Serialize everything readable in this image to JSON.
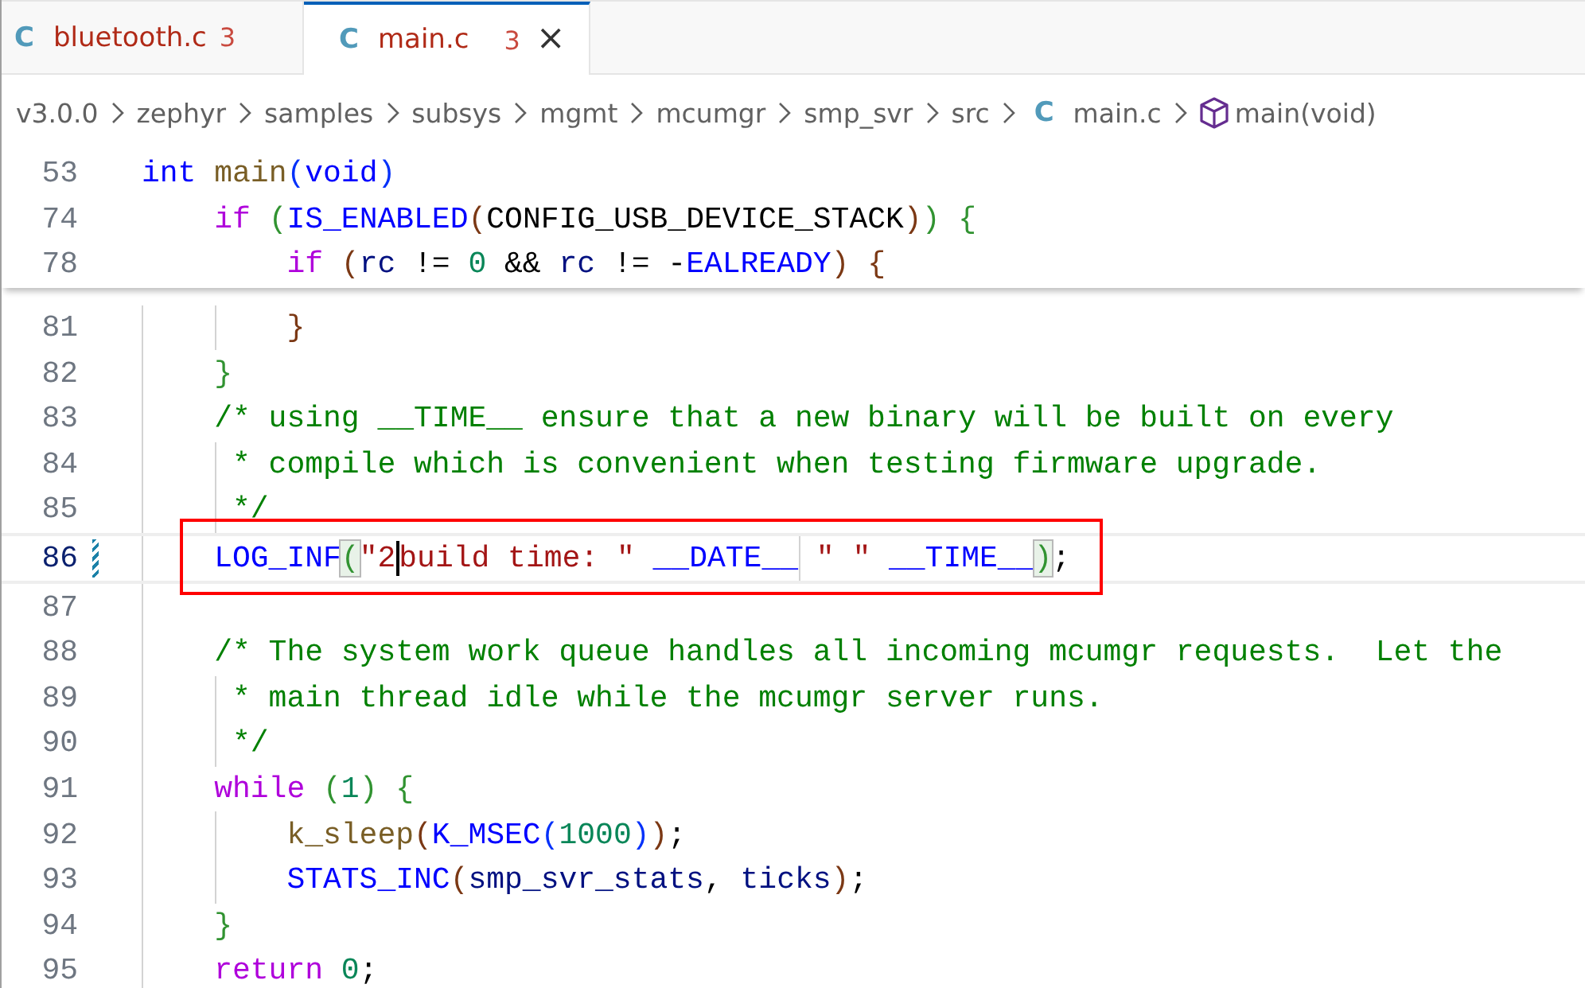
{
  "tabs": [
    {
      "icon": "C",
      "label": "bluetooth.c",
      "problems": "3",
      "selected": false
    },
    {
      "icon": "C",
      "label": "main.c",
      "problems": "3",
      "selected": true,
      "close": "×"
    }
  ],
  "breadcrumbs": [
    {
      "label": "v3.0.0",
      "kind": "folder"
    },
    {
      "label": "zephyr",
      "kind": "folder"
    },
    {
      "label": "samples",
      "kind": "folder"
    },
    {
      "label": "subsys",
      "kind": "folder"
    },
    {
      "label": "mgmt",
      "kind": "folder"
    },
    {
      "label": "mcumgr",
      "kind": "folder"
    },
    {
      "label": "smp_svr",
      "kind": "folder"
    },
    {
      "label": "src",
      "kind": "folder"
    },
    {
      "label": "main.c",
      "kind": "file",
      "icon": "C"
    },
    {
      "label": "main(void)",
      "kind": "symbol"
    }
  ],
  "sticky_lines": [
    {
      "number": "53",
      "tokens": [
        {
          "text": "int ",
          "kind": "kw"
        },
        {
          "text": "main",
          "kind": "fn"
        },
        {
          "text": "(",
          "kind": "b1"
        },
        {
          "text": "void",
          "kind": "kw"
        },
        {
          "text": ")",
          "kind": "b1"
        }
      ]
    },
    {
      "number": "74",
      "tokens": [
        {
          "text": "    if ",
          "kind": "ctrl"
        },
        {
          "text": "(",
          "kind": "b2"
        },
        {
          "text": "IS_ENABLED",
          "kind": "macro"
        },
        {
          "text": "(",
          "kind": "b3"
        },
        {
          "text": "CONFIG_USB_DEVICE_STACK",
          "kind": "plain"
        },
        {
          "text": ")",
          "kind": "b3"
        },
        {
          "text": ") ",
          "kind": "b2"
        },
        {
          "text": "{",
          "kind": "b2"
        }
      ]
    },
    {
      "number": "78",
      "tokens": [
        {
          "text": "        if ",
          "kind": "ctrl"
        },
        {
          "text": "(",
          "kind": "b3"
        },
        {
          "text": "rc",
          "kind": "var"
        },
        {
          "text": " != ",
          "kind": "plain"
        },
        {
          "text": "0",
          "kind": "num"
        },
        {
          "text": " && ",
          "kind": "plain"
        },
        {
          "text": "rc",
          "kind": "var"
        },
        {
          "text": " != -",
          "kind": "plain"
        },
        {
          "text": "EALREADY",
          "kind": "macro"
        },
        {
          "text": ") ",
          "kind": "b3"
        },
        {
          "text": "{",
          "kind": "b3"
        }
      ]
    }
  ],
  "lines": [
    {
      "number": "81",
      "tokens": [
        {
          "text": "        }",
          "kind": "b3"
        }
      ]
    },
    {
      "number": "82",
      "tokens": [
        {
          "text": "    }",
          "kind": "b2"
        }
      ]
    },
    {
      "number": "83",
      "tokens": [
        {
          "text": "    /* using __TIME__ ensure that a new binary will be built on every",
          "kind": "comment"
        }
      ]
    },
    {
      "number": "84",
      "tokens": [
        {
          "text": "     * compile which is convenient when testing firmware upgrade.",
          "kind": "comment"
        }
      ]
    },
    {
      "number": "85",
      "tokens": [
        {
          "text": "     */",
          "kind": "comment"
        }
      ]
    },
    {
      "number": "86",
      "current": true,
      "modified": true,
      "highlighted": true,
      "tokens": [
        {
          "text": "    LOG_INF",
          "kind": "macro"
        },
        {
          "text": "(",
          "kind": "b2",
          "matched": true
        },
        {
          "text": "\"2",
          "kind": "str",
          "cursor": true
        },
        {
          "text": "build time: \" ",
          "kind": "str"
        },
        {
          "text": "__DATE__",
          "kind": "macro"
        },
        {
          "text": " \" \" ",
          "kind": "str"
        },
        {
          "text": "__TIME__",
          "kind": "macro"
        },
        {
          "text": ")",
          "kind": "b2",
          "matched": true
        },
        {
          "text": ";",
          "kind": "plain"
        }
      ]
    },
    {
      "number": "87"
    },
    {
      "number": "88",
      "tokens": [
        {
          "text": "    /* The system work queue handles all incoming mcumgr requests.  Let the",
          "kind": "comment"
        }
      ]
    },
    {
      "number": "89",
      "tokens": [
        {
          "text": "     * main thread idle while the mcumgr server runs.",
          "kind": "comment"
        }
      ]
    },
    {
      "number": "90",
      "tokens": [
        {
          "text": "     */",
          "kind": "comment"
        }
      ]
    },
    {
      "number": "91",
      "tokens": [
        {
          "text": "    while ",
          "kind": "ctrl"
        },
        {
          "text": "(",
          "kind": "b2"
        },
        {
          "text": "1",
          "kind": "num"
        },
        {
          "text": ") ",
          "kind": "b2"
        },
        {
          "text": "{",
          "kind": "b2"
        }
      ]
    },
    {
      "number": "92",
      "tokens": [
        {
          "text": "        k_sleep",
          "kind": "fn"
        },
        {
          "text": "(",
          "kind": "b3"
        },
        {
          "text": "K_MSEC",
          "kind": "macro"
        },
        {
          "text": "(",
          "kind": "b1"
        },
        {
          "text": "1000",
          "kind": "num"
        },
        {
          "text": ")",
          "kind": "b1"
        },
        {
          "text": ")",
          "kind": "b3"
        },
        {
          "text": ";",
          "kind": "plain"
        }
      ]
    },
    {
      "number": "93",
      "tokens": [
        {
          "text": "        STATS_INC",
          "kind": "macro"
        },
        {
          "text": "(",
          "kind": "b3"
        },
        {
          "text": "smp_svr_stats",
          "kind": "var"
        },
        {
          "text": ", ",
          "kind": "plain"
        },
        {
          "text": "ticks",
          "kind": "var"
        },
        {
          "text": ")",
          "kind": "b3"
        },
        {
          "text": ";",
          "kind": "plain"
        }
      ]
    },
    {
      "number": "94",
      "tokens": [
        {
          "text": "    }",
          "kind": "b2"
        }
      ]
    },
    {
      "number": "95",
      "tokens": [
        {
          "text": "    return ",
          "kind": "ctrl"
        },
        {
          "text": "0",
          "kind": "num"
        },
        {
          "text": ";",
          "kind": "plain"
        }
      ]
    }
  ]
}
